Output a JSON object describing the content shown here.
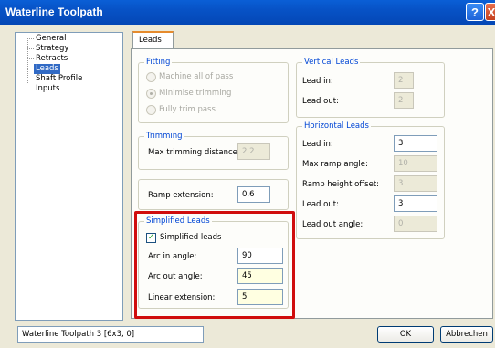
{
  "window": {
    "title": "Waterline Toolpath",
    "help_label": "?",
    "close_label": "X"
  },
  "tree": {
    "items": [
      "General",
      "Strategy",
      "Retracts",
      "Leads",
      "Shaft Profile",
      "Inputs"
    ]
  },
  "tab": {
    "label": "Leads"
  },
  "fitting": {
    "title": "Fitting",
    "options": [
      "Machine all of pass",
      "Minimise trimming",
      "Fully trim pass"
    ],
    "selected": "Minimise trimming"
  },
  "trimming": {
    "title": "Trimming",
    "max_label": "Max trimming distance:",
    "max_value": "2.2"
  },
  "ramp": {
    "label": "Ramp extension:",
    "value": "0.6"
  },
  "simplified": {
    "title": "Simplified Leads",
    "checkbox_label": "Simplified leads",
    "checked": true,
    "arc_in_label": "Arc in angle:",
    "arc_in_value": "90",
    "arc_out_label": "Arc out angle:",
    "arc_out_value": "45",
    "linear_label": "Linear extension:",
    "linear_value": "5"
  },
  "vertical": {
    "title": "Vertical Leads",
    "lead_in_label": "Lead in:",
    "lead_in_value": "2",
    "lead_out_label": "Lead out:",
    "lead_out_value": "2"
  },
  "horizontal": {
    "title": "Horizontal Leads",
    "lead_in_label": "Lead in:",
    "lead_in_value": "3",
    "max_ramp_label": "Max ramp angle:",
    "max_ramp_value": "10",
    "ramp_height_label": "Ramp height offset:",
    "ramp_height_value": "3",
    "lead_out_label": "Lead out:",
    "lead_out_value": "3",
    "lead_out_angle_label": "Lead out angle:",
    "lead_out_angle_value": "0"
  },
  "footer": {
    "status_text": "Waterline Toolpath 3 [6x3, 0]",
    "ok_label": "OK",
    "cancel_label": "Abbrechen"
  },
  "colors": {
    "highlight": "#d00d0d",
    "group_title": "#0046d5",
    "selection": "#316ac5"
  }
}
